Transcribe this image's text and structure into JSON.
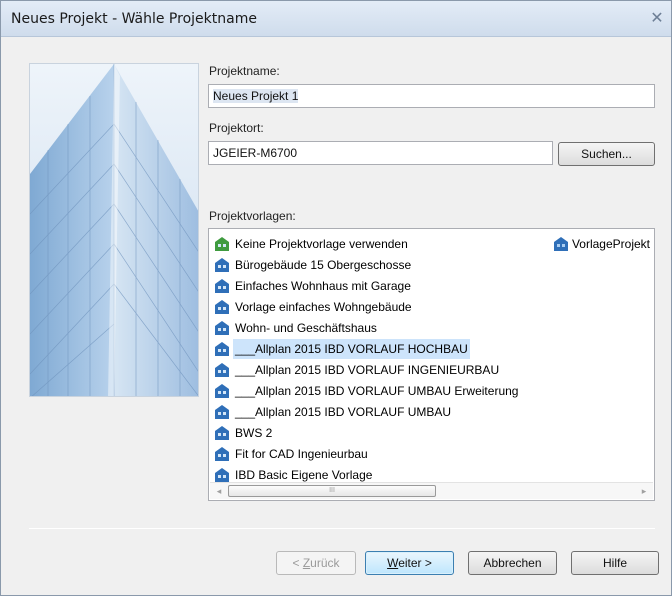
{
  "window": {
    "title": "Neues Projekt - Wähle Projektname",
    "close_glyph": "✕"
  },
  "form": {
    "name_label": "Projektname:",
    "name_value": "Neues Projekt 1",
    "location_label": "Projektort:",
    "location_value": "JGEIER-M6700",
    "search_button": "Suchen...",
    "templates_label": "Projektvorlagen:"
  },
  "templates": {
    "selected_index": 5,
    "items": [
      {
        "label": "Keine Projektvorlage verwenden",
        "icon": "building-green-icon"
      },
      {
        "label": "Bürogebäude 15 Obergeschosse",
        "icon": "building-blue-icon"
      },
      {
        "label": "Einfaches Wohnhaus mit Garage",
        "icon": "building-blue-icon"
      },
      {
        "label": "Vorlage einfaches Wohngebäude",
        "icon": "building-blue-icon"
      },
      {
        "label": "Wohn- und Geschäftshaus",
        "icon": "building-blue-icon"
      },
      {
        "label": "___Allplan 2015 IBD VORLAUF HOCHBAU",
        "icon": "building-blue-icon"
      },
      {
        "label": "___Allplan 2015 IBD VORLAUF INGENIEURBAU",
        "icon": "building-blue-icon"
      },
      {
        "label": "___Allplan 2015 IBD VORLAUF UMBAU Erweiterung",
        "icon": "building-blue-icon"
      },
      {
        "label": "___Allplan 2015 IBD VORLAUF UMBAU",
        "icon": "building-blue-icon"
      },
      {
        "label": "BWS 2",
        "icon": "building-blue-icon"
      },
      {
        "label": "Fit for CAD Ingenieurbau",
        "icon": "building-blue-icon"
      },
      {
        "label": "IBD Basic Eigene Vorlage",
        "icon": "building-blue-icon"
      }
    ],
    "right_item": {
      "label": "VorlageProjekt",
      "icon": "building-blue-icon"
    },
    "scroll_left": "◂",
    "scroll_right": "▸",
    "scroll_grip": "III"
  },
  "buttons": {
    "back_prefix": "< ",
    "back_mnemonic": "Z",
    "back_rest": "urück",
    "next_mnemonic": "W",
    "next_rest": "eiter >",
    "cancel": "Abbrechen",
    "help": "Hilfe"
  },
  "colors": {
    "selection": "#cde4fb",
    "title_bar": "#dbe6f4",
    "icon_blue": "#2f6fb8",
    "icon_green": "#3f9b3f"
  }
}
